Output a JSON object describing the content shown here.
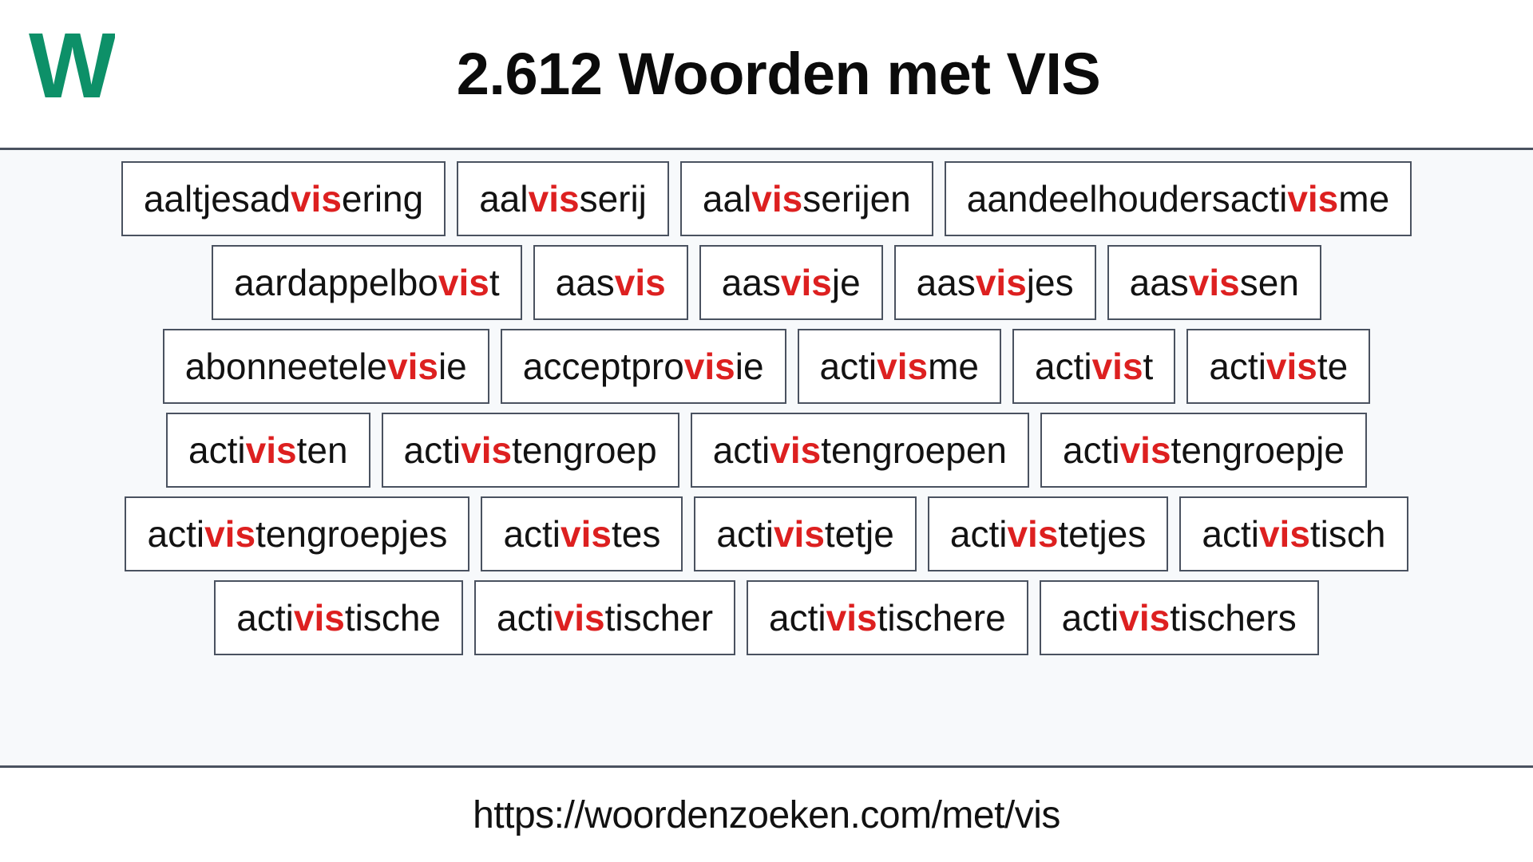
{
  "header": {
    "logo_letter": "W",
    "logo_color": "#0d9068",
    "title": "2.612 Woorden met VIS"
  },
  "theme": {
    "highlight_color": "#dd2020",
    "border_color": "#4a5260",
    "page_background": "#ffffff",
    "main_background": "#f7f9fb",
    "text_color": "#121212"
  },
  "search": {
    "pattern": "vis"
  },
  "main": {
    "rows": [
      {
        "words": [
          {
            "prefix": "aaltjesad",
            "match": "vis",
            "suffix": "ering",
            "full": "aaltjesadvisering"
          },
          {
            "prefix": "aal",
            "match": "vis",
            "suffix": "serij",
            "full": "aalvisserij"
          },
          {
            "prefix": "aal",
            "match": "vis",
            "suffix": "serijen",
            "full": "aalvisserijen"
          },
          {
            "prefix": "aandeelhoudersacti",
            "match": "vis",
            "suffix": "me",
            "full": "aandeelhoudersactivisme"
          }
        ]
      },
      {
        "words": [
          {
            "prefix": "aardappelbo",
            "match": "vis",
            "suffix": "t",
            "full": "aardappelbovist"
          },
          {
            "prefix": "aas",
            "match": "vis",
            "suffix": "",
            "full": "aasvis"
          },
          {
            "prefix": "aas",
            "match": "vis",
            "suffix": "je",
            "full": "aasvisje"
          },
          {
            "prefix": "aas",
            "match": "vis",
            "suffix": "jes",
            "full": "aasvisjes"
          },
          {
            "prefix": "aas",
            "match": "vis",
            "suffix": "sen",
            "full": "aasvissen"
          }
        ]
      },
      {
        "words": [
          {
            "prefix": "abonneetele",
            "match": "vis",
            "suffix": "ie",
            "full": "abonneetelevisie"
          },
          {
            "prefix": "acceptpro",
            "match": "vis",
            "suffix": "ie",
            "full": "acceptprovisie"
          },
          {
            "prefix": "acti",
            "match": "vis",
            "suffix": "me",
            "full": "activisme"
          },
          {
            "prefix": "acti",
            "match": "vis",
            "suffix": "t",
            "full": "activist"
          },
          {
            "prefix": "acti",
            "match": "vis",
            "suffix": "te",
            "full": "activiste"
          }
        ]
      },
      {
        "words": [
          {
            "prefix": "acti",
            "match": "vis",
            "suffix": "ten",
            "full": "activisten"
          },
          {
            "prefix": "acti",
            "match": "vis",
            "suffix": "tengroep",
            "full": "activistengroep"
          },
          {
            "prefix": "acti",
            "match": "vis",
            "suffix": "tengroepen",
            "full": "activistengroepen"
          },
          {
            "prefix": "acti",
            "match": "vis",
            "suffix": "tengroepje",
            "full": "activistengroepje"
          }
        ]
      },
      {
        "words": [
          {
            "prefix": "acti",
            "match": "vis",
            "suffix": "tengroepjes",
            "full": "activistengroepjes"
          },
          {
            "prefix": "acti",
            "match": "vis",
            "suffix": "tes",
            "full": "activistes"
          },
          {
            "prefix": "acti",
            "match": "vis",
            "suffix": "tetje",
            "full": "activistetje"
          },
          {
            "prefix": "acti",
            "match": "vis",
            "suffix": "tetjes",
            "full": "activistetjes"
          },
          {
            "prefix": "acti",
            "match": "vis",
            "suffix": "tisch",
            "full": "activistisch"
          }
        ]
      },
      {
        "words": [
          {
            "prefix": "acti",
            "match": "vis",
            "suffix": "tische",
            "full": "activistische"
          },
          {
            "prefix": "acti",
            "match": "vis",
            "suffix": "tischer",
            "full": "activistischer"
          },
          {
            "prefix": "acti",
            "match": "vis",
            "suffix": "tischere",
            "full": "activistischere"
          },
          {
            "prefix": "acti",
            "match": "vis",
            "suffix": "tischers",
            "full": "activistischers"
          }
        ]
      }
    ]
  },
  "footer": {
    "url": "https://woordenzoeken.com/met/vis"
  }
}
